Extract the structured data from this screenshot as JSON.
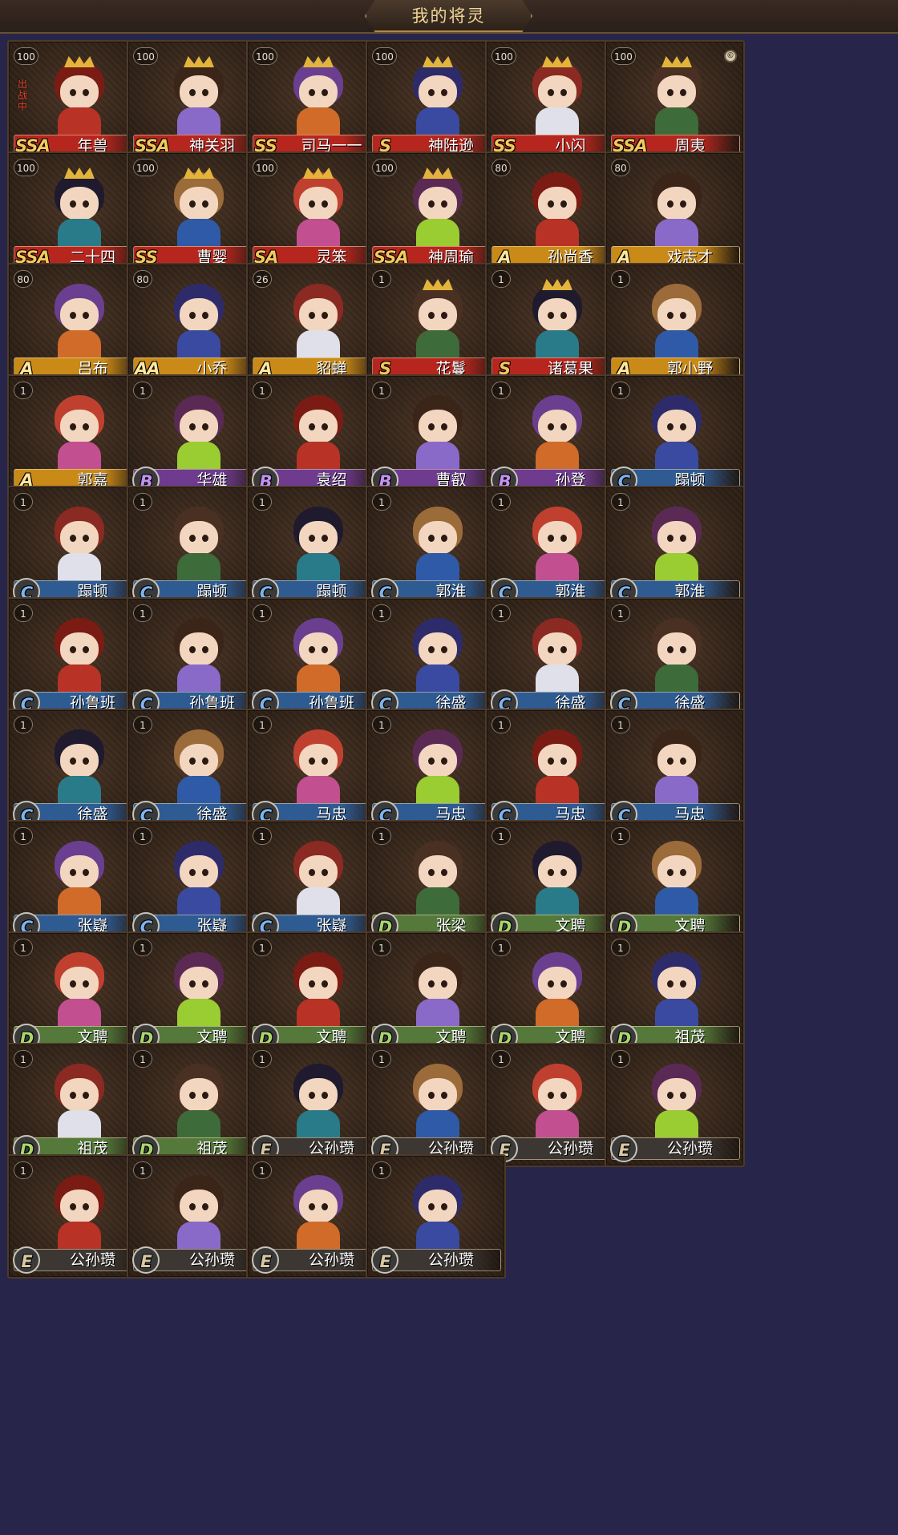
{
  "header": {
    "title": "我的将灵"
  },
  "status_text": {
    "in_battle": "出战中"
  },
  "icons": {
    "equip": "©"
  },
  "colors": {
    "SSA": "#b7261e",
    "SS": "#b7261e",
    "S": "#b7261e",
    "A": "#c98a18",
    "AA": "#c98a18",
    "B": "#6e3b8f",
    "C": "#2f5b93",
    "D": "#54793a",
    "E": "#3d3733",
    "rank_text_red": "#f0ca5b",
    "rank_text_gold": "#fde7a0",
    "rank_text_purple": "#c292ee",
    "rank_text_blue": "#7cb4f0",
    "rank_text_green": "#a9d66a",
    "rank_text_grey": "#d9c7a2"
  },
  "generals": [
    {
      "name": "年兽",
      "level": "100",
      "rank": "SSA",
      "equip": true,
      "in_battle": true
    },
    {
      "name": "神关羽",
      "level": "100",
      "rank": "SSA",
      "equip": true
    },
    {
      "name": "司马一一",
      "level": "100",
      "rank": "SS"
    },
    {
      "name": "神陆逊",
      "level": "100",
      "rank": "S",
      "equip": true
    },
    {
      "name": "小闪",
      "level": "100",
      "rank": "SS"
    },
    {
      "name": "周夷",
      "level": "100",
      "rank": "SSA",
      "equip": true
    },
    {
      "name": "二十四",
      "level": "100",
      "rank": "SSA",
      "equip": true
    },
    {
      "name": "曹婴",
      "level": "100",
      "rank": "SS"
    },
    {
      "name": "灵笨",
      "level": "100",
      "rank": "SA"
    },
    {
      "name": "神周瑜",
      "level": "100",
      "rank": "SSA"
    },
    {
      "name": "孙尚香",
      "level": "80",
      "rank": "A"
    },
    {
      "name": "戏志才",
      "level": "80",
      "rank": "A"
    },
    {
      "name": "吕布",
      "level": "80",
      "rank": "A"
    },
    {
      "name": "小乔",
      "level": "80",
      "rank": "AA"
    },
    {
      "name": "貂蝉",
      "level": "26",
      "rank": "A"
    },
    {
      "name": "花鬘",
      "level": "1",
      "rank": "S"
    },
    {
      "name": "诸葛果",
      "level": "1",
      "rank": "S"
    },
    {
      "name": "郭小野",
      "level": "1",
      "rank": "A"
    },
    {
      "name": "郭嘉",
      "level": "1",
      "rank": "A"
    },
    {
      "name": "华雄",
      "level": "1",
      "rank": "B"
    },
    {
      "name": "袁绍",
      "level": "1",
      "rank": "B"
    },
    {
      "name": "曹叡",
      "level": "1",
      "rank": "B"
    },
    {
      "name": "孙登",
      "level": "1",
      "rank": "B"
    },
    {
      "name": "蹋顿",
      "level": "1",
      "rank": "C"
    },
    {
      "name": "蹋顿",
      "level": "1",
      "rank": "C"
    },
    {
      "name": "蹋顿",
      "level": "1",
      "rank": "C"
    },
    {
      "name": "蹋顿",
      "level": "1",
      "rank": "C"
    },
    {
      "name": "郭淮",
      "level": "1",
      "rank": "C"
    },
    {
      "name": "郭淮",
      "level": "1",
      "rank": "C"
    },
    {
      "name": "郭淮",
      "level": "1",
      "rank": "C"
    },
    {
      "name": "孙鲁班",
      "level": "1",
      "rank": "C"
    },
    {
      "name": "孙鲁班",
      "level": "1",
      "rank": "C"
    },
    {
      "name": "孙鲁班",
      "level": "1",
      "rank": "C"
    },
    {
      "name": "徐盛",
      "level": "1",
      "rank": "C"
    },
    {
      "name": "徐盛",
      "level": "1",
      "rank": "C"
    },
    {
      "name": "徐盛",
      "level": "1",
      "rank": "C"
    },
    {
      "name": "徐盛",
      "level": "1",
      "rank": "C"
    },
    {
      "name": "徐盛",
      "level": "1",
      "rank": "C"
    },
    {
      "name": "马忠",
      "level": "1",
      "rank": "C"
    },
    {
      "name": "马忠",
      "level": "1",
      "rank": "C"
    },
    {
      "name": "马忠",
      "level": "1",
      "rank": "C"
    },
    {
      "name": "马忠",
      "level": "1",
      "rank": "C"
    },
    {
      "name": "张嶷",
      "level": "1",
      "rank": "C"
    },
    {
      "name": "张嶷",
      "level": "1",
      "rank": "C"
    },
    {
      "name": "张嶷",
      "level": "1",
      "rank": "C"
    },
    {
      "name": "张梁",
      "level": "1",
      "rank": "D"
    },
    {
      "name": "文聘",
      "level": "1",
      "rank": "D"
    },
    {
      "name": "文聘",
      "level": "1",
      "rank": "D"
    },
    {
      "name": "文聘",
      "level": "1",
      "rank": "D"
    },
    {
      "name": "文聘",
      "level": "1",
      "rank": "D"
    },
    {
      "name": "文聘",
      "level": "1",
      "rank": "D"
    },
    {
      "name": "文聘",
      "level": "1",
      "rank": "D"
    },
    {
      "name": "文聘",
      "level": "1",
      "rank": "D"
    },
    {
      "name": "祖茂",
      "level": "1",
      "rank": "D"
    },
    {
      "name": "祖茂",
      "level": "1",
      "rank": "D"
    },
    {
      "name": "祖茂",
      "level": "1",
      "rank": "D"
    },
    {
      "name": "公孙瓒",
      "level": "1",
      "rank": "E"
    },
    {
      "name": "公孙瓒",
      "level": "1",
      "rank": "E"
    },
    {
      "name": "公孙瓒",
      "level": "1",
      "rank": "E"
    },
    {
      "name": "公孙瓒",
      "level": "1",
      "rank": "E"
    },
    {
      "name": "公孙瓒",
      "level": "1",
      "rank": "E"
    },
    {
      "name": "公孙瓒",
      "level": "1",
      "rank": "E"
    },
    {
      "name": "公孙瓒",
      "level": "1",
      "rank": "E"
    },
    {
      "name": "公孙瓒",
      "level": "1",
      "rank": "E"
    }
  ]
}
